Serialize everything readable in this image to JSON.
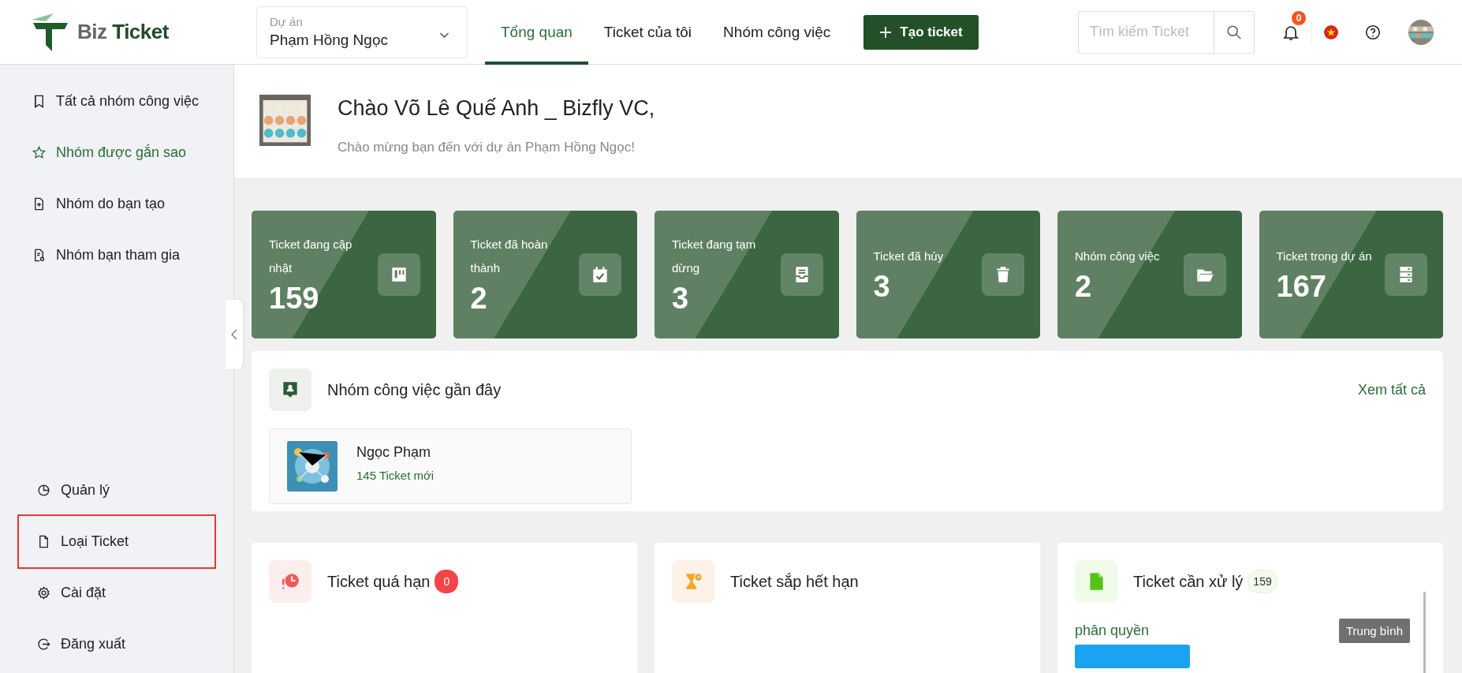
{
  "header": {
    "logo": {
      "part_1": "Biz",
      "part_2": "Ticket"
    },
    "project_select": {
      "label": "Dự án",
      "value": "Phạm Hồng Ngọc"
    },
    "tabs": [
      {
        "label": "Tổng quan",
        "selected": true
      },
      {
        "label": "Ticket của tôi",
        "selected": false
      },
      {
        "label": "Nhóm công việc",
        "selected": false
      }
    ],
    "create_button": "Tạo ticket",
    "search": {
      "placeholder": "Tìm kiếm Ticket"
    },
    "notification_count": "0"
  },
  "sidebar": {
    "top_items": [
      {
        "label": "Tất cả nhóm công việc",
        "selected": false
      },
      {
        "label": "Nhóm được gắn sao",
        "selected": true
      },
      {
        "label": "Nhóm do bạn tạo",
        "selected": false
      },
      {
        "label": "Nhóm bạn tham gia",
        "selected": false
      }
    ],
    "bottom_items": [
      {
        "label": "Quản lý",
        "highlighted": false
      },
      {
        "label": "Loại Ticket",
        "highlighted": true
      },
      {
        "label": "Cài đặt",
        "highlighted": false
      },
      {
        "label": "Đăng xuất",
        "highlighted": false
      }
    ]
  },
  "greeting": {
    "title": "Chào Võ Lê Quế Anh _ Bizfly VC,",
    "subtitle": "Chào mừng bạn đến với dự án Phạm Hồng Ngọc!"
  },
  "stats": [
    {
      "label": "Ticket đang cập nhật",
      "value": "159"
    },
    {
      "label": "Ticket đã hoàn thành",
      "value": "2"
    },
    {
      "label": "Ticket đang tạm dừng",
      "value": "3"
    },
    {
      "label": "Ticket đã hủy",
      "value": "3"
    },
    {
      "label": "Nhóm công việc",
      "value": "2"
    },
    {
      "label": "Ticket trong dự án",
      "value": "167"
    }
  ],
  "recent_groups": {
    "title": "Nhóm công việc gần đây",
    "link": "Xem tất cả",
    "groups": [
      {
        "name": "Ngọc Phạm",
        "count": "145 Ticket mới"
      }
    ]
  },
  "panels": [
    {
      "title": "Ticket quá hạn",
      "badge": "0"
    },
    {
      "title": "Ticket sắp hết hạn"
    },
    {
      "title": "Ticket cần xử lý",
      "badge": "159",
      "items": [
        {
          "title": "phân quyền",
          "priority": "Trung bình"
        }
      ]
    }
  ]
}
